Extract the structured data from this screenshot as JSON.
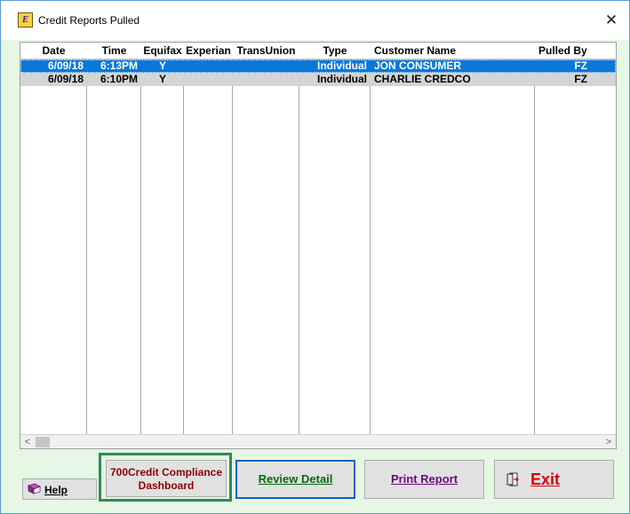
{
  "window": {
    "title": "Credit Reports Pulled",
    "icon": "app-logo-icon",
    "close_glyph": "✕",
    "app_icon_letter": "E"
  },
  "grid": {
    "columns": [
      {
        "key": "date",
        "label": "Date"
      },
      {
        "key": "time",
        "label": "Time"
      },
      {
        "key": "equifax",
        "label": "Equifax"
      },
      {
        "key": "experian",
        "label": "Experian"
      },
      {
        "key": "transunion",
        "label": "TransUnion"
      },
      {
        "key": "type",
        "label": "Type"
      },
      {
        "key": "customer",
        "label": "Customer Name"
      },
      {
        "key": "pulled_by",
        "label": "Pulled By"
      }
    ],
    "rows": [
      {
        "date": "6/09/18",
        "time": "6:13PM",
        "equifax": "Y",
        "experian": "",
        "transunion": "",
        "type": "Individual",
        "customer": "JON CONSUMER",
        "pulled_by": "FZ",
        "selected": true
      },
      {
        "date": "6/09/18",
        "time": "6:10PM",
        "equifax": "Y",
        "experian": "",
        "transunion": "",
        "type": "Individual",
        "customer": "CHARLIE CREDCO",
        "pulled_by": "FZ",
        "selected": false
      }
    ],
    "scroll_left_glyph": "<",
    "scroll_right_glyph": ">"
  },
  "buttons": {
    "help": "Help",
    "compliance_line1": "700Credit Compliance",
    "compliance_line2": "Dashboard",
    "review": "Review Detail",
    "print": "Print Report",
    "exit": "Exit"
  },
  "colors": {
    "selection": "#0b78d7",
    "alt_row": "#d4d4d4",
    "background": "#e6f7e4",
    "compliance_highlight": "#2e8b57",
    "exit_text": "#e00000"
  }
}
